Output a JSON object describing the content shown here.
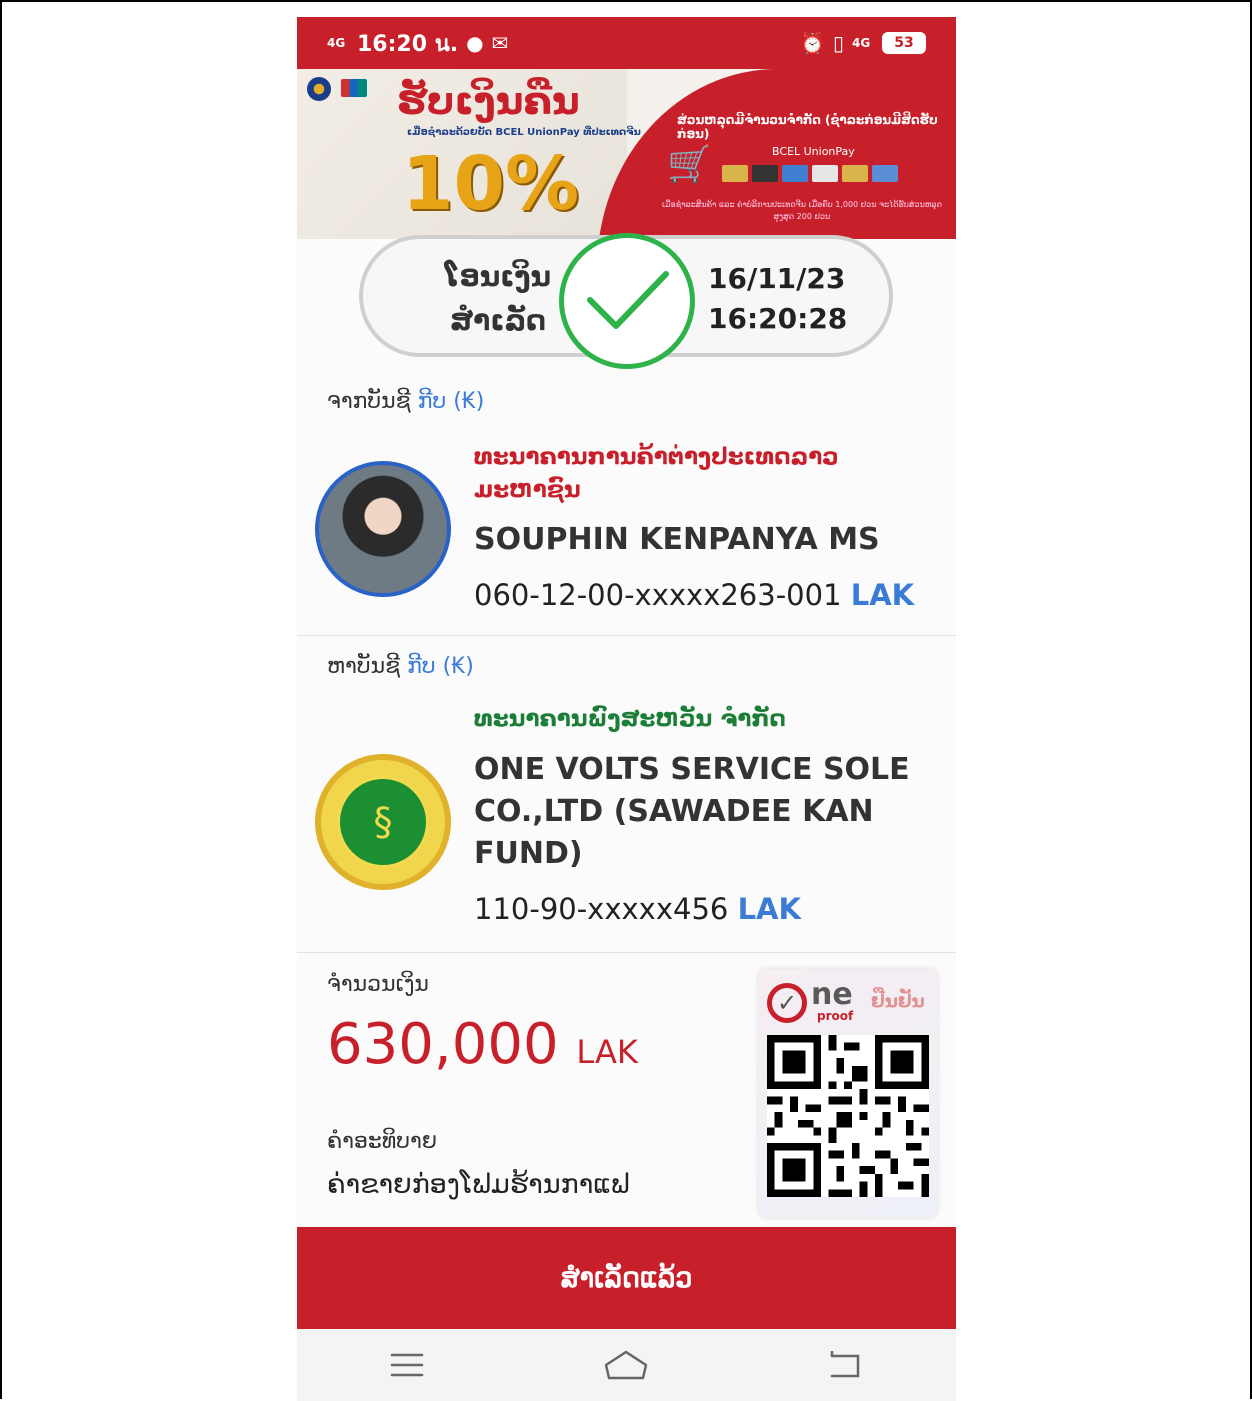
{
  "status_bar": {
    "network": "4G",
    "time": "16:20 น.",
    "battery": "53",
    "network_right": "4G"
  },
  "banner": {
    "title": "ຮັບເງິນຄືນ",
    "subtitle": "ເມື່ອຊຳລະດ້ວຍບັດ BCEL UnionPay ທີ່ປະເທດຈີນ",
    "percent": "10%",
    "right_title": "ສ່ວນຫລຸດມີຈຳນວນຈຳກັດ (ຊຳລະກ່ອນມີສິດຮັບກ່ອນ)",
    "brand": "BCEL UnionPay",
    "fine_print": "ເມື່ອຊຳລະສິນຄ້າ ແລະ ຄ່າບໍລິການປະເທດຈີນ ເມື່ອຄົບ 1,000 ຢວນ ຈະໄດ້ຮັບສ່ວນຫລຸດສູງສຸດ 200 ຢວນ"
  },
  "status": {
    "line1": "ໂອນເງິນ",
    "line2": "ສຳເລັດ",
    "date": "16/11/23",
    "time": "16:20:28"
  },
  "from": {
    "label": "ຈາກບັນຊີ",
    "currency_label": "ກີບ (₭)",
    "bank": "ທະນາຄານການຄ້າຕ່າງປະເທດລາວ ມະຫາຊົນ",
    "name": "SOUPHIN KENPANYA MS",
    "account": "060-12-00-xxxxx263-001",
    "currency": "LAK"
  },
  "to": {
    "label": "ຫາບັນຊີ",
    "currency_label": "ກີບ (₭)",
    "bank": "ທະນາຄານພົງສະຫວັນ ຈຳກັດ",
    "name": "ONE VOLTS SERVICE SOLE CO.,LTD (SAWADEE KAN FUND)",
    "account": "110-90-xxxxx456",
    "currency": "LAK"
  },
  "amount": {
    "label": "ຈຳນວນເງິນ",
    "value": "630,000",
    "unit": "LAK"
  },
  "description": {
    "label": "ຄຳອະທິບາຍ",
    "value": "ຄ່າຂາຍກ່ອງໂຟມຮ້ານກາແຟ"
  },
  "proof": {
    "brand": "ne",
    "sub": "proof",
    "confirm": "ຢືນຢັນ"
  },
  "done_button": "ສຳເລັດແລ້ວ",
  "colors": {
    "brand_red": "#c8202b",
    "success_green": "#2db34a",
    "link_blue": "#3a7bd5"
  },
  "icons": [
    "signal-icon",
    "line-icon",
    "mail-icon",
    "alarm-icon",
    "vibrate-icon",
    "battery-icon",
    "check-icon",
    "menu-icon",
    "home-icon",
    "back-icon"
  ]
}
